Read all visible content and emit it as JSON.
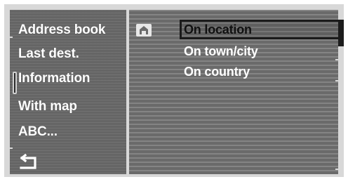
{
  "menu": {
    "items": [
      {
        "label": "Address book"
      },
      {
        "label": "Last dest."
      },
      {
        "label": "Information"
      },
      {
        "label": "With map"
      },
      {
        "label": "ABC..."
      }
    ],
    "selected_index": 2,
    "back_icon": "back-arrow-icon"
  },
  "options": {
    "items": [
      {
        "label": "On location"
      },
      {
        "label": "On town/city"
      },
      {
        "label": "On country"
      }
    ],
    "selected_index": 0,
    "leading_icon": "home-icon"
  },
  "colors": {
    "left_panel": "#6b6b6b",
    "right_panel": "#767676",
    "text": "#ffffff",
    "selection_border": "#1a1a1a"
  }
}
